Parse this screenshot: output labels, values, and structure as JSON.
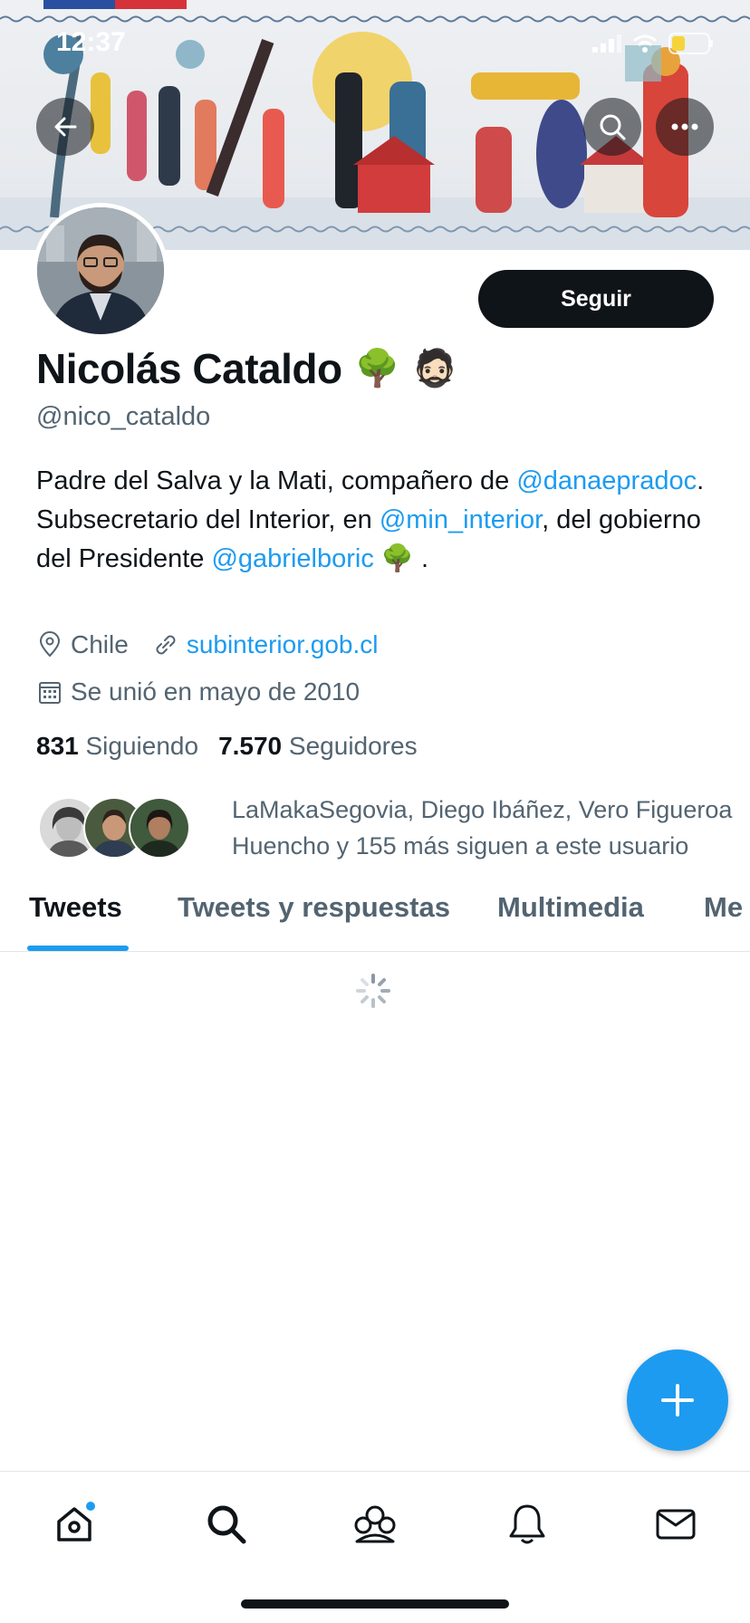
{
  "status_bar": {
    "time": "12:37"
  },
  "profile": {
    "name": "Nicolás Cataldo",
    "name_emojis": [
      "🌳",
      "🧔🏻"
    ],
    "handle": "@nico_cataldo",
    "follow_label": "Seguir",
    "bio": {
      "part1": "Padre del Salva y la Mati, compañero de ",
      "mention1": "@danaepradoc",
      "part2": ". Subsecretario del Interior, en ",
      "mention2": "@min_interior",
      "part3": ", del gobierno del Presidente ",
      "mention3": "@gabrielboric",
      "part4": " 🌳 ."
    },
    "location": "Chile",
    "website": "subinterior.gob.cl",
    "joined": "Se unió en mayo de 2010",
    "following_count": "831",
    "following_label": "Siguiendo",
    "followers_count": "7.570",
    "followers_label": "Seguidores",
    "known_followers": "LaMakaSegovia, Diego Ibáñez, Vero Figueroa Huencho y 155 más siguen a este usuario"
  },
  "tabs": [
    {
      "label": "Tweets",
      "active": true
    },
    {
      "label": "Tweets y respuestas"
    },
    {
      "label": "Multimedia"
    },
    {
      "label": "Me"
    }
  ],
  "icons": {
    "back": "arrow-left-icon",
    "search": "search-icon",
    "more": "more-icon",
    "compose": "plus-icon",
    "nav": [
      "home-icon",
      "search-icon",
      "communities-icon",
      "bell-icon",
      "mail-icon"
    ]
  },
  "colors": {
    "accent": "#1d9bf0",
    "text": "#0f1419",
    "muted": "#536471"
  }
}
